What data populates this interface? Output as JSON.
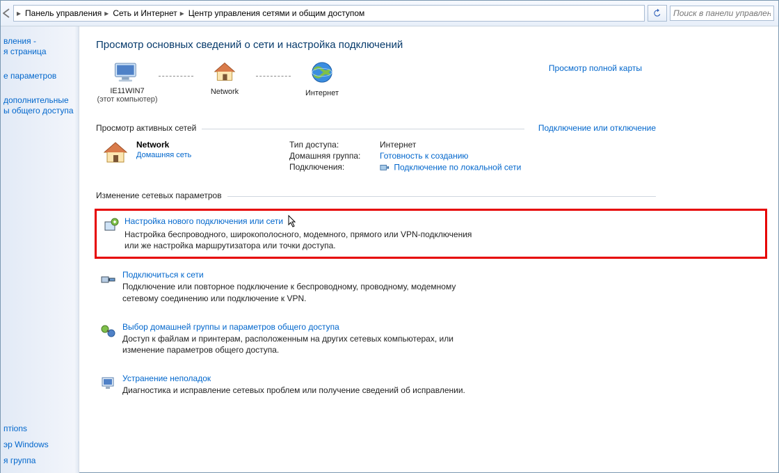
{
  "breadcrumbs": {
    "item1": "Панель управления",
    "item2": "Сеть и Интернет",
    "item3": "Центр управления сетями и общим доступом"
  },
  "search": {
    "placeholder": "Поиск в панели управления"
  },
  "sidebar": {
    "item0a": "вления -",
    "item0b": "я страница",
    "item1": "е параметров",
    "item2a": " дополнительные",
    "item2b": "ы общего доступа",
    "sa1": "птions",
    "sa2": "эр Windows",
    "sa3": "я группа"
  },
  "page": {
    "title": "Просмотр основных сведений о сети и настройка подключений"
  },
  "map": {
    "full_link": "Просмотр полной карты",
    "this_pc": "IE11WIN7",
    "this_pc_sub": "(этот компьютер)",
    "network": "Network",
    "internet": "Интернет"
  },
  "active": {
    "section": "Просмотр активных сетей",
    "section_link": "Подключение или отключение",
    "name": "Network",
    "type_link": "Домашняя сеть",
    "k1": "Тип доступа:",
    "v1": "Интернет",
    "k2": "Домашняя группа:",
    "v2": "Готовность к созданию",
    "k3": "Подключения:",
    "v3": "Подключение по локальной сети"
  },
  "change": {
    "section": "Изменение сетевых параметров"
  },
  "tasks": {
    "t1_title": "Настройка нового подключения или сети",
    "t1_desc": "Настройка беспроводного, широкополосного, модемного, прямого или VPN-подключения или же настройка маршрутизатора или точки доступа.",
    "t2_title": "Подключиться к сети",
    "t2_desc": "Подключение или повторное подключение к беспроводному, проводному, модемному сетевому соединению или подключение к VPN.",
    "t3_title": "Выбор домашней группы и параметров общего доступа",
    "t3_desc": "Доступ к файлам и принтерам, расположенным на других сетевых компьютерах, или изменение параметров общего доступа.",
    "t4_title": "Устранение неполадок",
    "t4_desc": "Диагностика и исправление сетевых проблем или получение сведений об исправлении."
  }
}
